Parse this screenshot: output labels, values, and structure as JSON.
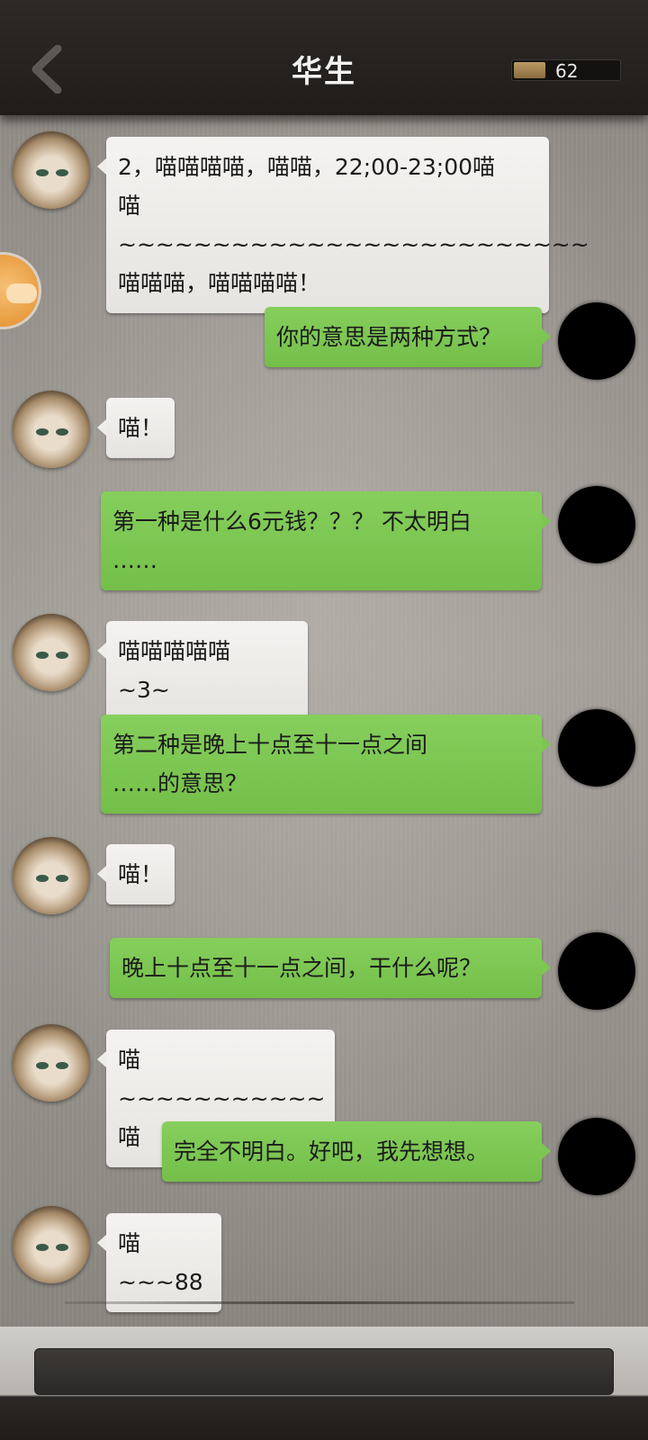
{
  "header": {
    "title": "华生",
    "back_icon": "chevron-left-icon",
    "counter_value": "62",
    "counter_fill_fraction": 0.3
  },
  "colors": {
    "incoming_bubble": "#efedeb",
    "outgoing_bubble": "#7cc652",
    "header_bg": "#262321",
    "accent_gold": "#a8874f"
  },
  "messages": [
    {
      "side": "left",
      "text": "2，喵喵喵喵，喵喵，22;00-23;00喵\n喵~~~~~~~~~~~~~~~~~~~~~~~~~\n喵喵喵，喵喵喵喵！"
    },
    {
      "side": "right",
      "text": "你的意思是两种方式？"
    },
    {
      "side": "left",
      "text": "喵！"
    },
    {
      "side": "right",
      "text": "第一种是什么6元钱？？？ 不太明白\n……"
    },
    {
      "side": "left",
      "text": "喵喵喵喵喵  ~3~"
    },
    {
      "side": "right",
      "text": "第二种是晚上十点至十一点之间\n……的意思？"
    },
    {
      "side": "left",
      "text": "喵！"
    },
    {
      "side": "right",
      "text": "晚上十点至十一点之间，干什么呢？"
    },
    {
      "side": "left",
      "text": "喵~~~~~~~~~~~喵"
    },
    {
      "side": "right",
      "text": "完全不明白。好吧，我先想想。"
    },
    {
      "side": "left",
      "text": "喵~~~88"
    }
  ],
  "input": {
    "placeholder": ""
  }
}
